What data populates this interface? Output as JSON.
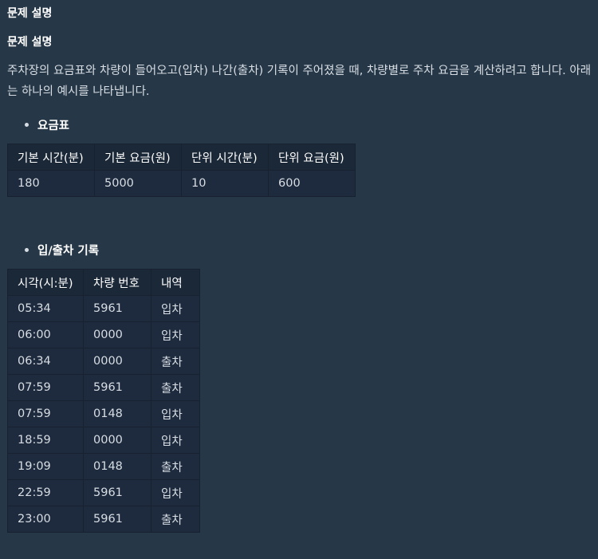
{
  "page_title": "문제 설명",
  "section_heading": "문제 설명",
  "intro_text": "주차장의 요금표와 차량이 들어오고(입차) 나간(출차) 기록이 주어졌을 때, 차량별로 주차 요금을 계산하려고 합니다. 아래는 하나의 예시를 나타냅니다.",
  "fee_section": {
    "label": "요금표",
    "headers": [
      "기본 시간(분)",
      "기본 요금(원)",
      "단위 시간(분)",
      "단위 요금(원)"
    ],
    "row": [
      "180",
      "5000",
      "10",
      "600"
    ]
  },
  "record_section": {
    "label": "입/출차 기록",
    "headers": [
      "시각(시:분)",
      "차량 번호",
      "내역"
    ],
    "rows": [
      [
        "05:34",
        "5961",
        "입차"
      ],
      [
        "06:00",
        "0000",
        "입차"
      ],
      [
        "06:34",
        "0000",
        "출차"
      ],
      [
        "07:59",
        "5961",
        "출차"
      ],
      [
        "07:59",
        "0148",
        "입차"
      ],
      [
        "18:59",
        "0000",
        "입차"
      ],
      [
        "19:09",
        "0148",
        "출차"
      ],
      [
        "22:59",
        "5961",
        "입차"
      ],
      [
        "23:00",
        "5961",
        "출차"
      ]
    ]
  }
}
